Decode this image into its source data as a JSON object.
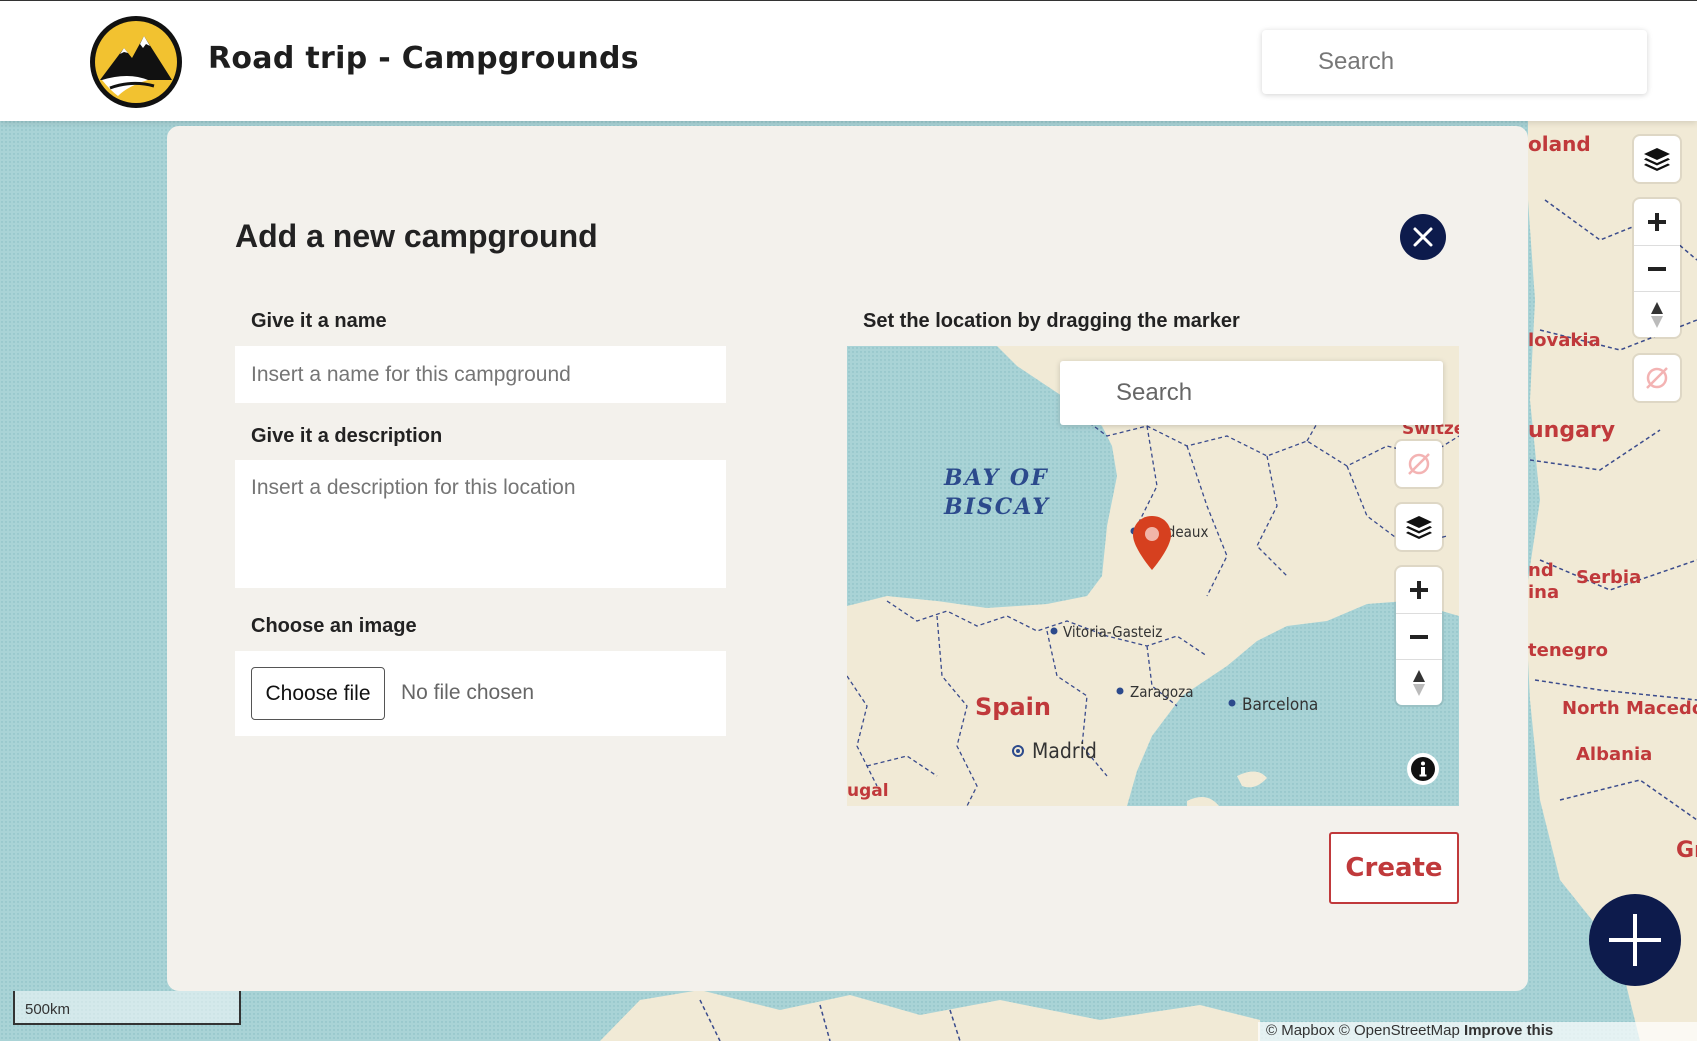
{
  "header": {
    "title": "Road trip - Campgrounds",
    "search_placeholder": "Search"
  },
  "background_map": {
    "labels": [
      "oland",
      "lovakia",
      "ungary",
      "Serbia",
      "nd",
      "ina",
      "tenegro",
      "North Macedon",
      "Albania",
      "Gr"
    ],
    "scale": "500km",
    "attribution_prefix": "© Mapbox © OpenStreetMap",
    "attribution_link": "Improve this"
  },
  "modal": {
    "title": "Add a new campground",
    "name_label": "Give it a name",
    "name_placeholder": "Insert a name for this campground",
    "description_label": "Give it a description",
    "description_placeholder": "Insert a description for this location",
    "image_label": "Choose an image",
    "choose_file": "Choose file",
    "no_file": "No file chosen",
    "location_label": "Set the location by dragging the marker",
    "create": "Create"
  },
  "mini_map": {
    "search_placeholder": "Search",
    "sea": "BAY OF BISCAY",
    "sea_line1": "BAY OF",
    "sea_line2": "BISCAY",
    "countries": {
      "spain": "Spain",
      "switzerland_partial": "Switze",
      "portugal_partial": "ugal"
    },
    "cities": {
      "bordeaux": "Bordeaux",
      "vitoria": "Vitoria-Gasteiz",
      "zaragoza": "Zaragoza",
      "barcelona": "Barcelona",
      "madrid": "Madrid"
    }
  },
  "colors": {
    "navy": "#0d1b4c",
    "accent_red": "#c0393b",
    "water": "#a9d3d6",
    "land": "#f1ead6",
    "modal_bg": "#f3f1ec",
    "marker": "#d6401f"
  },
  "icons": [
    "logo-mountain-icon",
    "layers-icon",
    "zoom-in-icon",
    "zoom-out-icon",
    "compass-icon",
    "geolocate-disabled-icon",
    "close-icon",
    "info-icon",
    "map-marker-icon",
    "plus-icon"
  ]
}
